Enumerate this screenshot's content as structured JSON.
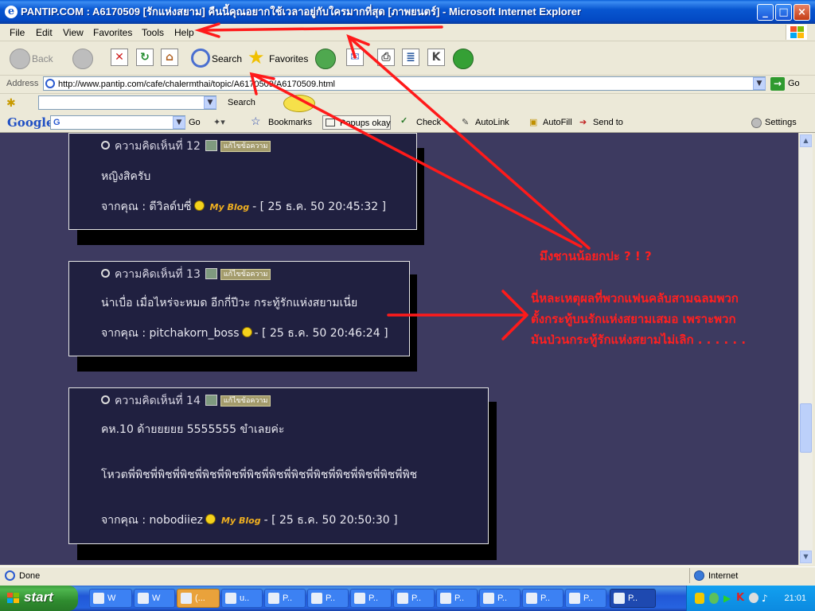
{
  "window": {
    "title": "PANTIP.COM : A6170509 [รักแห่งสยาม] คืนนี้คุณอยากใช้เวลาอยู่กับใครมากที่สุด [ภาพยนตร์] - Microsoft Internet Explorer",
    "minimize": "_",
    "maximize": "□",
    "close": "×"
  },
  "menu": [
    "File",
    "Edit",
    "View",
    "Favorites",
    "Tools",
    "Help"
  ],
  "toolbar": {
    "back": "Back",
    "search": "Search",
    "favorites": "Favorites"
  },
  "address": {
    "label": "Address",
    "url": "http://www.pantip.com/cafe/chalermthai/topic/A6170509/A6170509.html",
    "go": "Go"
  },
  "searchbar": {
    "search_button": "Search"
  },
  "googlebar": {
    "logo": "Google",
    "input_value": "G",
    "go": "Go",
    "bookmarks": "Bookmarks",
    "popups": "Popups okay",
    "check": "Check",
    "autolink": "AutoLink",
    "autofill": "AutoFill",
    "sendto": "Send to",
    "settings": "Settings"
  },
  "comments": [
    {
      "header": "ความคิดเห็นที่ 12",
      "edit_label": "แก้ไขข้อความ",
      "lines": [
        "หญิงสิครับ"
      ],
      "from_prefix": "จากคุณ : ดีวิลด์บซี่",
      "has_blog": true,
      "timestamp": "- [ 25 ธ.ค. 50 20:45:32 ]"
    },
    {
      "header": "ความคิดเห็นที่ 13",
      "edit_label": "แก้ไขข้อความ",
      "lines": [
        "น่าเบื่อ เมื่อไหร่จะหมด อีกกี่ปีวะ กระทู้รักแห่งสยามเนี่ย"
      ],
      "from_prefix": "จากคุณ : pitchakorn_boss",
      "has_blog": false,
      "timestamp": "- [ 25 ธ.ค. 50 20:46:24 ]"
    },
    {
      "header": "ความคิดเห็นที่ 14",
      "edit_label": "แก้ไขข้อความ",
      "lines": [
        "คห.10 ด้ายยยยย 5555555 ขำเลยค่ะ",
        "โหวตพี่พิชพี่พิชพี่พิชพี่พิชพี่พิชพี่พิชพี่พิชพี่พิชพี่พิชพี่พิชพี่พิชพี่พิชพี่พิช"
      ],
      "from_prefix": "จากคุณ : nobodiiez",
      "has_blog": true,
      "timestamp": "- [ 25 ธ.ค. 50 20:50:30 ]"
    }
  ],
  "myblog_label": "My Blog",
  "annotations": {
    "question": "มึงชานน้อยกปะ ? ! ?",
    "reason_line1": "นี่หละเหตุผลที่พวกแฟนคลับสามฉลมพวก",
    "reason_line2": "ตั้งกระทู้บนรักแห่งสยามเสมอ เพราะพวก",
    "reason_line3": "มันป่วนกระทู้รักแห่งสยามไม่เลิก . . . . . ."
  },
  "status": {
    "text": "Done",
    "zone": "Internet"
  },
  "taskbar": {
    "start": "start",
    "tasks": [
      "W",
      "W",
      "(...",
      "u..",
      "P..",
      "P..",
      "P..",
      "P..",
      "P..",
      "P..",
      "P..",
      "P..",
      "P.."
    ],
    "clock": "21:01"
  },
  "colors": {
    "page_background": "#3d3a60",
    "comment_background": "#202040",
    "annotation": "#ff2020"
  }
}
